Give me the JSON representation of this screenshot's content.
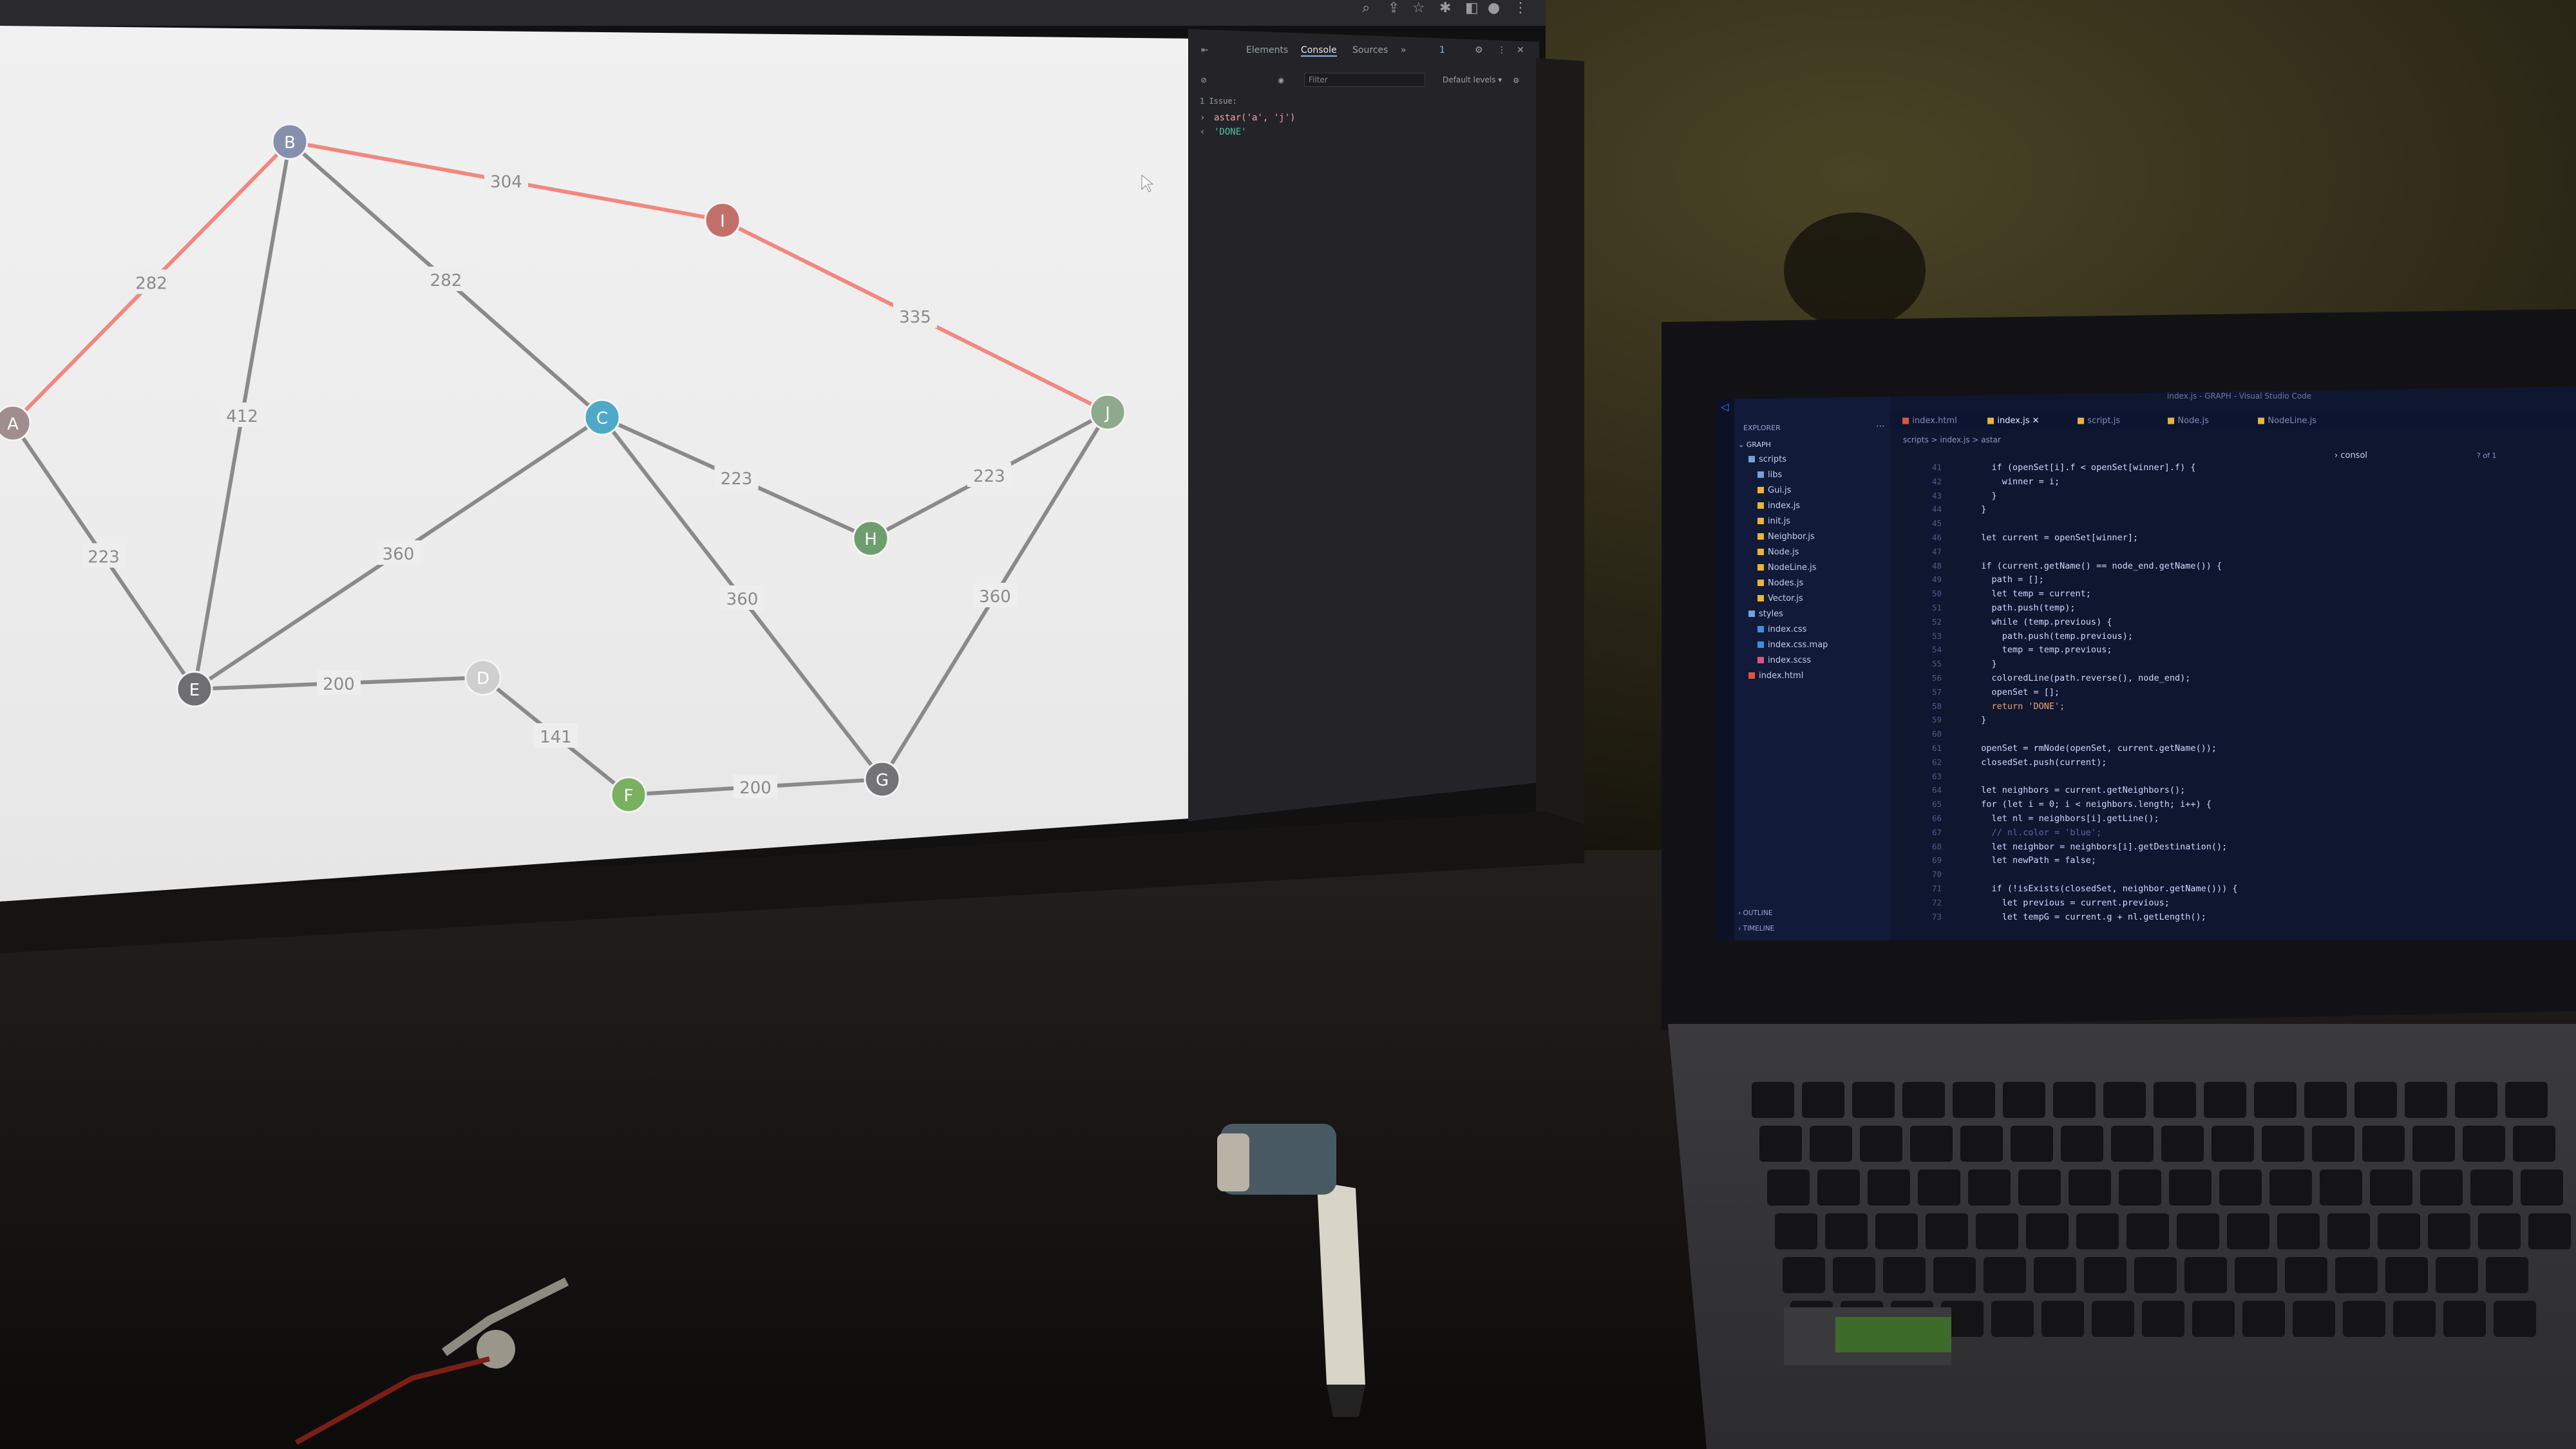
{
  "graph": {
    "nodes": [
      {
        "id": "A",
        "color": "#a08d8d"
      },
      {
        "id": "B",
        "color": "#8690ae"
      },
      {
        "id": "C",
        "color": "#4ea9c8"
      },
      {
        "id": "E",
        "color": "#6f6f72"
      },
      {
        "id": "D",
        "color": "#cfcfcf"
      },
      {
        "id": "F",
        "color": "#7ab160"
      },
      {
        "id": "G",
        "color": "#747478"
      },
      {
        "id": "H",
        "color": "#6e9e6e"
      },
      {
        "id": "I",
        "color": "#c4706a"
      },
      {
        "id": "J",
        "color": "#8fa98c"
      }
    ],
    "edges": [
      {
        "from": "A",
        "to": "B",
        "weight": "282",
        "on_path": true
      },
      {
        "from": "B",
        "to": "I",
        "weight": "304",
        "on_path": true
      },
      {
        "from": "I",
        "to": "J",
        "weight": "335",
        "on_path": true
      },
      {
        "from": "B",
        "to": "C",
        "weight": "282",
        "on_path": false
      },
      {
        "from": "B",
        "to": "E",
        "weight": "412",
        "on_path": false
      },
      {
        "from": "A",
        "to": "E",
        "weight": "223",
        "on_path": false
      },
      {
        "from": "E",
        "to": "C",
        "weight": "360",
        "on_path": false
      },
      {
        "from": "C",
        "to": "H",
        "weight": "223",
        "on_path": false
      },
      {
        "from": "H",
        "to": "J",
        "weight": "223",
        "on_path": false
      },
      {
        "from": "C",
        "to": "G",
        "weight": "360",
        "on_path": false
      },
      {
        "from": "J",
        "to": "G",
        "weight": "360",
        "on_path": false
      },
      {
        "from": "E",
        "to": "D",
        "weight": "200",
        "on_path": false
      },
      {
        "from": "D",
        "to": "F",
        "weight": "141",
        "on_path": false
      },
      {
        "from": "F",
        "to": "G",
        "weight": "200",
        "on_path": false
      }
    ],
    "path_color": "#f08880",
    "edge_color": "#8a8a8a"
  },
  "devtools": {
    "tabs": [
      "Elements",
      "Console",
      "Sources"
    ],
    "active_tab": "Console",
    "filter_placeholder": "Filter",
    "levels": "Default levels ▾",
    "issues": "1 Issue: ",
    "issue_count": "1",
    "console_input": "astar('a', 'j')",
    "console_output": "'DONE'"
  },
  "vscode": {
    "title": "index.js - GRAPH - Visual Studio Code",
    "explorer_label": "EXPLORER",
    "root_folder": "GRAPH",
    "tabs": [
      {
        "name": "index.html",
        "active": false
      },
      {
        "name": "index.js",
        "active": true
      },
      {
        "name": "script.js",
        "active": false
      },
      {
        "name": "Node.js",
        "active": false
      },
      {
        "name": "NodeLine.js",
        "active": false
      }
    ],
    "breadcrumb": "scripts > index.js > astar",
    "find_text": "consol",
    "find_result": "? of 1",
    "tree": [
      {
        "name": "scripts",
        "type": "folder",
        "depth": 1
      },
      {
        "name": "libs",
        "type": "folder",
        "depth": 2
      },
      {
        "name": "Gui.js",
        "type": "js",
        "depth": 2
      },
      {
        "name": "index.js",
        "type": "js",
        "depth": 2
      },
      {
        "name": "init.js",
        "type": "js",
        "depth": 2
      },
      {
        "name": "Neighbor.js",
        "type": "js",
        "depth": 2
      },
      {
        "name": "Node.js",
        "type": "js",
        "depth": 2
      },
      {
        "name": "NodeLine.js",
        "type": "js",
        "depth": 2
      },
      {
        "name": "Nodes.js",
        "type": "js",
        "depth": 2
      },
      {
        "name": "Vector.js",
        "type": "js",
        "depth": 2
      },
      {
        "name": "styles",
        "type": "folder",
        "depth": 1
      },
      {
        "name": "index.css",
        "type": "css",
        "depth": 2
      },
      {
        "name": "index.css.map",
        "type": "css",
        "depth": 2
      },
      {
        "name": "index.scss",
        "type": "scss",
        "depth": 2
      },
      {
        "name": "index.html",
        "type": "html",
        "depth": 1
      }
    ],
    "outline_label": "OUTLINE",
    "timeline_label": "TIMELINE",
    "code": [
      {
        "n": "41",
        "t": "    if (openSet[i].f < openSet[winner].f) {"
      },
      {
        "n": "42",
        "t": "      winner = i;"
      },
      {
        "n": "43",
        "t": "    }"
      },
      {
        "n": "44",
        "t": "  }"
      },
      {
        "n": "45",
        "t": ""
      },
      {
        "n": "46",
        "t": "  let current = openSet[winner];"
      },
      {
        "n": "47",
        "t": ""
      },
      {
        "n": "48",
        "t": "  if (current.getName() == node_end.getName()) {"
      },
      {
        "n": "49",
        "t": "    path = [];"
      },
      {
        "n": "50",
        "t": "    let temp = current;"
      },
      {
        "n": "51",
        "t": "    path.push(temp);"
      },
      {
        "n": "52",
        "t": "    while (temp.previous) {"
      },
      {
        "n": "53",
        "t": "      path.push(temp.previous);"
      },
      {
        "n": "54",
        "t": "      temp = temp.previous;"
      },
      {
        "n": "55",
        "t": "    }"
      },
      {
        "n": "56",
        "t": "    coloredLine(path.reverse(), node_end);"
      },
      {
        "n": "57",
        "t": "    openSet = [];"
      },
      {
        "n": "58",
        "t": "    return 'DONE';"
      },
      {
        "n": "59",
        "t": "  }"
      },
      {
        "n": "60",
        "t": ""
      },
      {
        "n": "61",
        "t": "  openSet = rmNode(openSet, current.getName());"
      },
      {
        "n": "62",
        "t": "  closedSet.push(current);"
      },
      {
        "n": "63",
        "t": ""
      },
      {
        "n": "64",
        "t": "  let neighbors = current.getNeighbors();"
      },
      {
        "n": "65",
        "t": "  for (let i = 0; i < neighbors.length; i++) {"
      },
      {
        "n": "66",
        "t": "    let nl = neighbors[i].getLine();"
      },
      {
        "n": "67",
        "t": "    // nl.color = 'blue';"
      },
      {
        "n": "68",
        "t": "    let neighbor = neighbors[i].getDestination();"
      },
      {
        "n": "69",
        "t": "    let newPath = false;"
      },
      {
        "n": "70",
        "t": ""
      },
      {
        "n": "71",
        "t": "    if (!isExists(closedSet, neighbor.getName())) {"
      },
      {
        "n": "72",
        "t": "      let previous = current.previous;"
      },
      {
        "n": "73",
        "t": "      let tempG = current.g + nl.getLength();"
      }
    ]
  }
}
